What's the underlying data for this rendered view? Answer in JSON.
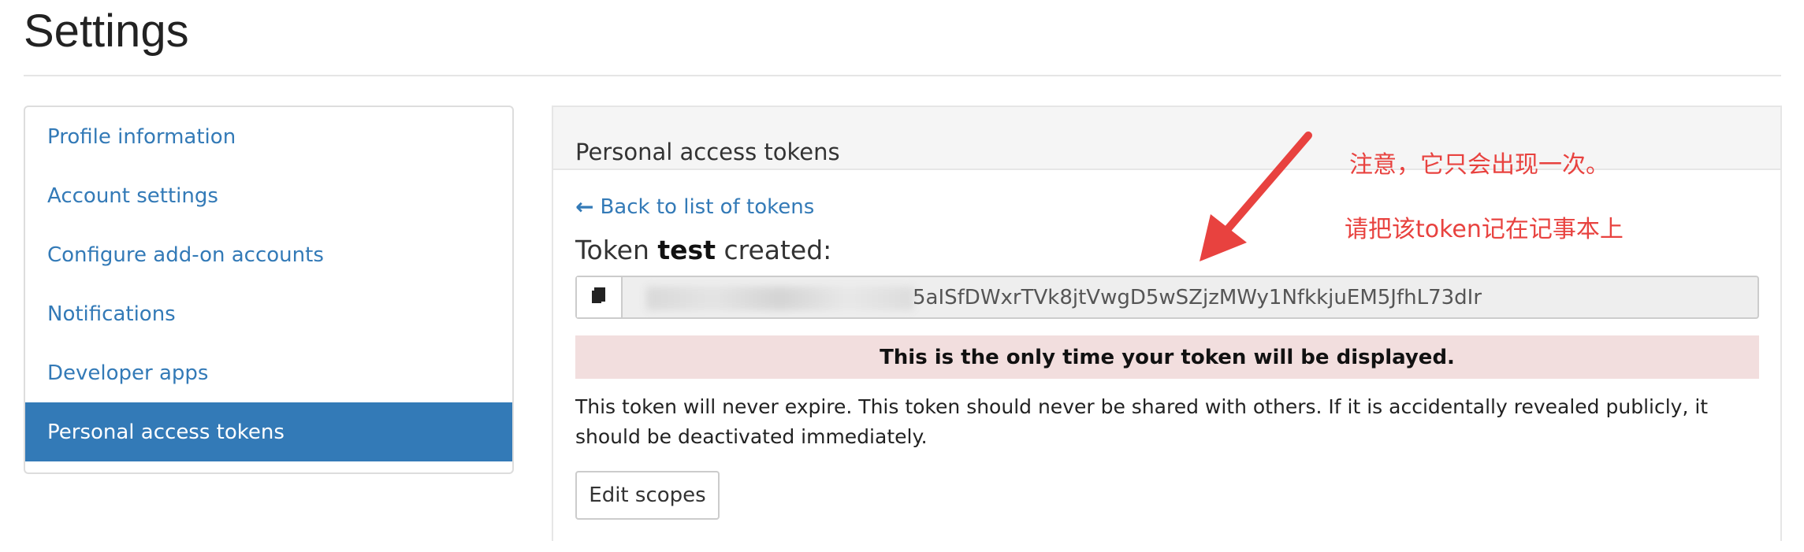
{
  "page": {
    "title": "Settings"
  },
  "sidebar": {
    "items": [
      {
        "label": "Profile information"
      },
      {
        "label": "Account settings"
      },
      {
        "label": "Configure add-on accounts"
      },
      {
        "label": "Notifications"
      },
      {
        "label": "Developer apps"
      },
      {
        "label": "Personal access tokens",
        "active": true
      }
    ]
  },
  "panel": {
    "heading": "Personal access tokens",
    "back_link": "Back to list of tokens",
    "token_created_prefix": "Token ",
    "token_name": "test",
    "token_created_suffix": " created:",
    "token_value_visible": "5aISfDWxrTVk8jtVwgD5wSZjzMWy1NfkkjuEM5JfhL73dIr",
    "warning": "This is the only time your token will be displayed.",
    "note": "This token will never expire. This token should never be shared with others. If it is accidentally revealed publicly, it should be deactivated immediately.",
    "edit_scopes_label": "Edit scopes"
  },
  "annotations": {
    "line1": "注意，它只会出现一次。",
    "line2": "请把该token记在记事本上"
  },
  "colors": {
    "accent": "#337ab7",
    "warning_bg": "#f2dede",
    "annotation": "#e8423f"
  },
  "icons": [
    "arrow-left-icon",
    "copy-icon",
    "annotation-arrow-icon"
  ]
}
